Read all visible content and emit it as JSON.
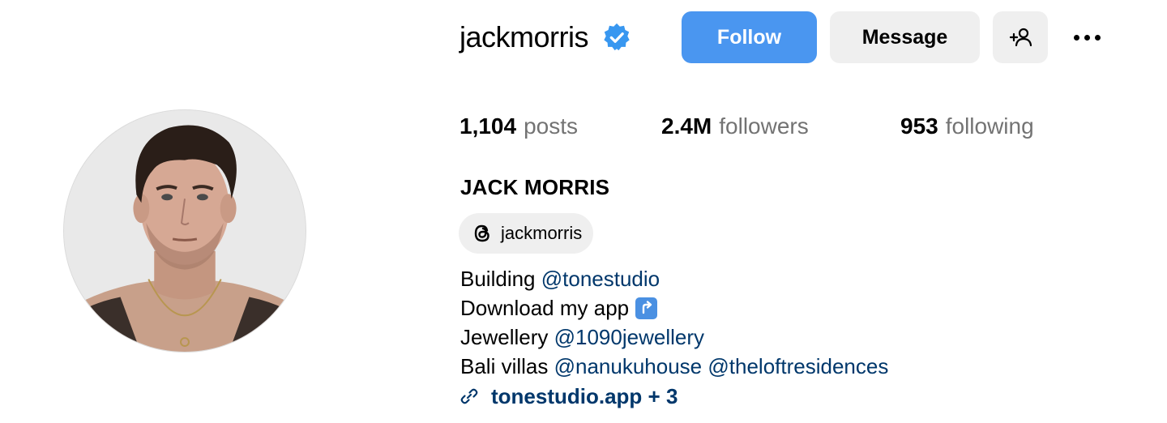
{
  "profile": {
    "username": "jackmorris",
    "verified": true,
    "full_name": "JACK MORRIS",
    "threads_handle": "jackmorris"
  },
  "actions": {
    "follow_label": "Follow",
    "message_label": "Message"
  },
  "stats": {
    "posts_count": "1,104",
    "posts_label": "posts",
    "followers_count": "2.4M",
    "followers_label": "followers",
    "following_count": "953",
    "following_label": "following"
  },
  "bio": {
    "line1_text": "Building",
    "line1_mention": "@tonestudio",
    "line2_text": "Download my app",
    "line2_icon": "up-right-arrow-icon",
    "line3_text": "Jewellery",
    "line3_mention": "@1090jewellery",
    "line4_text": "Bali villas",
    "line4_mention_a": "@nanukuhouse",
    "line4_mention_b": "@theloftresidences"
  },
  "link": {
    "text": "tonestudio.app + 3"
  },
  "colors": {
    "follow_button": "#4a96f0",
    "secondary_button": "#efefef",
    "mention_link": "#00376b",
    "muted_text": "#737373",
    "verified_badge": "#3897f0"
  },
  "icons": {
    "verified": "verified-badge-icon",
    "add_user": "add-user-icon",
    "more": "more-options-icon",
    "threads": "threads-icon",
    "link": "link-icon"
  }
}
